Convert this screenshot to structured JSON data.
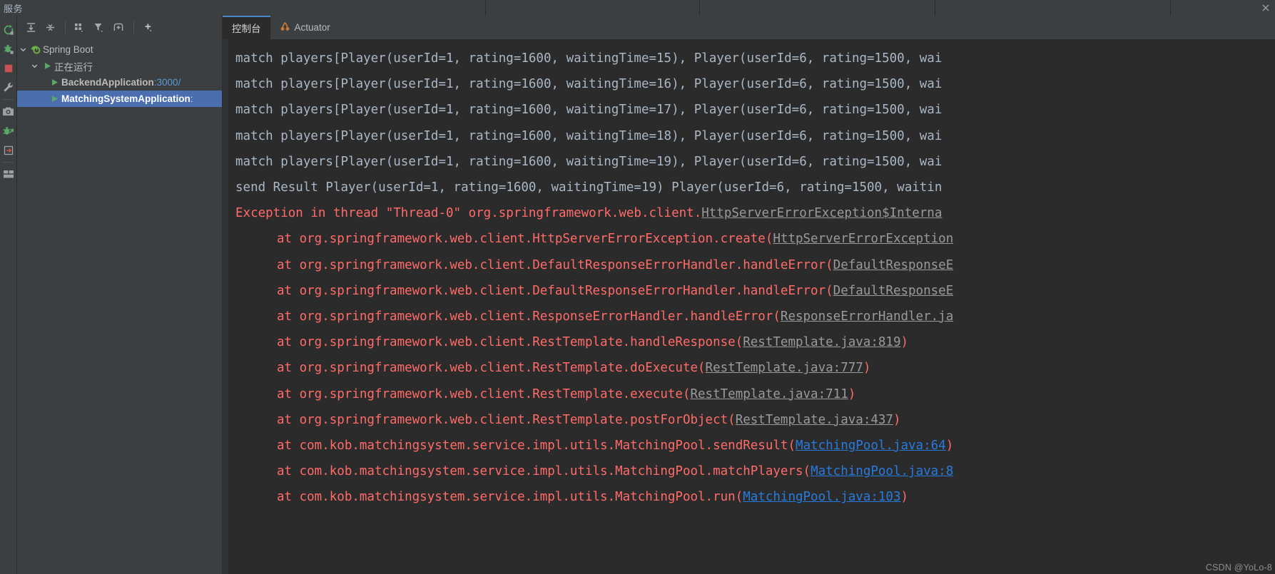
{
  "window": {
    "tool_window_title": "服务",
    "close_icon": "close-icon"
  },
  "rail": {
    "items": [
      {
        "name": "rerun-icon",
        "label": "rerun"
      },
      {
        "name": "debug-icon",
        "label": "debug"
      },
      {
        "name": "stop-icon",
        "label": "stop"
      },
      {
        "name": "settings-wrench-icon",
        "label": "settings"
      },
      {
        "name": "camera-icon",
        "label": "screenshot"
      },
      {
        "name": "attach-debugger-icon",
        "label": "attach debugger"
      },
      {
        "name": "export-icon",
        "label": "export"
      },
      {
        "name": "layout-icon",
        "label": "layout"
      }
    ]
  },
  "left_toolbar": {
    "buttons": [
      {
        "name": "expand-all-icon",
        "label": "Expand All"
      },
      {
        "name": "collapse-all-icon",
        "label": "Collapse All"
      },
      {
        "name": "group-by-icon",
        "label": "Group By"
      },
      {
        "name": "filter-icon",
        "label": "Filter"
      },
      {
        "name": "show-configurations-icon",
        "label": "Show Configurations"
      },
      {
        "name": "add-icon",
        "label": "Add"
      }
    ]
  },
  "tree": {
    "root": {
      "label": "Spring Boot",
      "icon": "spring-boot-icon",
      "expanded": true
    },
    "group": {
      "label": "正在运行",
      "icon": "run-triangle-icon",
      "expanded": true
    },
    "items": [
      {
        "label": "BackendApplication",
        "suffix": ":3000/",
        "icon": "run-triangle-icon",
        "selected": false
      },
      {
        "label": "MatchingSystemApplication",
        "suffix": ":",
        "icon": "run-triangle-icon",
        "selected": true
      }
    ]
  },
  "tabs": [
    {
      "label": "控制台",
      "icon": null,
      "active": true
    },
    {
      "label": "Actuator",
      "icon": "actuator-icon",
      "active": false
    }
  ],
  "console": {
    "lines": [
      {
        "type": "log",
        "text": "match players[Player(userId=1, rating=1600, waitingTime=15), Player(userId=6, rating=1500, wai"
      },
      {
        "type": "log",
        "text": "match players[Player(userId=1, rating=1600, waitingTime=16), Player(userId=6, rating=1500, wai"
      },
      {
        "type": "log",
        "text": "match players[Player(userId=1, rating=1600, waitingTime=17), Player(userId=6, rating=1500, wai"
      },
      {
        "type": "log",
        "text": "match players[Player(userId=1, rating=1600, waitingTime=18), Player(userId=6, rating=1500, wai"
      },
      {
        "type": "log",
        "text": "match players[Player(userId=1, rating=1600, waitingTime=19), Player(userId=6, rating=1500, wai"
      },
      {
        "type": "log",
        "text": "send Result Player(userId=1, rating=1600, waitingTime=19) Player(userId=6, rating=1500, waitin"
      },
      {
        "type": "error",
        "indent": false,
        "pre": "Exception in thread \"Thread-0\" org.springframework.web.client.",
        "link": "HttpServerErrorException$Interna",
        "link_style": "grey",
        "post": ""
      },
      {
        "type": "error",
        "indent": true,
        "pre": "at org.springframework.web.client.HttpServerErrorException.create(",
        "link": "HttpServerErrorException",
        "link_style": "grey",
        "post": ""
      },
      {
        "type": "error",
        "indent": true,
        "pre": "at org.springframework.web.client.DefaultResponseErrorHandler.handleError(",
        "link": "DefaultResponseE",
        "link_style": "grey",
        "post": ""
      },
      {
        "type": "error",
        "indent": true,
        "pre": "at org.springframework.web.client.DefaultResponseErrorHandler.handleError(",
        "link": "DefaultResponseE",
        "link_style": "grey",
        "post": ""
      },
      {
        "type": "error",
        "indent": true,
        "pre": "at org.springframework.web.client.ResponseErrorHandler.handleError(",
        "link": "ResponseErrorHandler.ja",
        "link_style": "grey",
        "post": ""
      },
      {
        "type": "error",
        "indent": true,
        "pre": "at org.springframework.web.client.RestTemplate.handleResponse(",
        "link": "RestTemplate.java:819",
        "link_style": "grey",
        "post": ")"
      },
      {
        "type": "error",
        "indent": true,
        "pre": "at org.springframework.web.client.RestTemplate.doExecute(",
        "link": "RestTemplate.java:777",
        "link_style": "grey",
        "post": ")"
      },
      {
        "type": "error",
        "indent": true,
        "pre": "at org.springframework.web.client.RestTemplate.execute(",
        "link": "RestTemplate.java:711",
        "link_style": "grey",
        "post": ")"
      },
      {
        "type": "error",
        "indent": true,
        "pre": "at org.springframework.web.client.RestTemplate.postForObject(",
        "link": "RestTemplate.java:437",
        "link_style": "grey",
        "post": ")"
      },
      {
        "type": "error",
        "indent": true,
        "pre": "at com.kob.matchingsystem.service.impl.utils.MatchingPool.sendResult(",
        "link": "MatchingPool.java:64",
        "link_style": "blue",
        "post": ")"
      },
      {
        "type": "error",
        "indent": true,
        "pre": "at com.kob.matchingsystem.service.impl.utils.MatchingPool.matchPlayers(",
        "link": "MatchingPool.java:8",
        "link_style": "blue",
        "post": ""
      },
      {
        "type": "error",
        "indent": true,
        "pre": "at com.kob.matchingsystem.service.impl.utils.MatchingPool.run(",
        "link": "MatchingPool.java:103",
        "link_style": "blue",
        "post": ")"
      }
    ]
  },
  "watermark": "CSDN @YoLo-8",
  "colors": {
    "panel_bg": "#3c3f41",
    "console_bg": "#2b2b2b",
    "error_red": "#ff6b68",
    "link_blue": "#287bde",
    "selection_blue": "#4b6eaf",
    "tab_accent": "#4a88c7",
    "text": "#bbbbbb"
  }
}
